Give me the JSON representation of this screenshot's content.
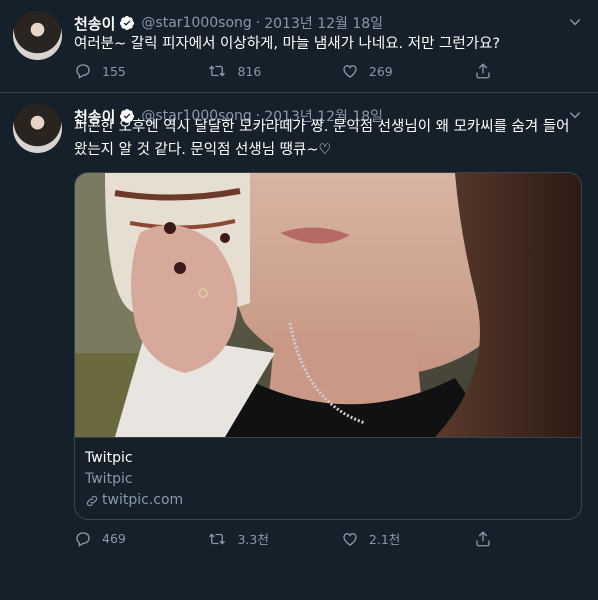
{
  "tweets": [
    {
      "author": "천송이",
      "handle": "@star1000song",
      "separator": "·",
      "date": "2013년 12월 18일",
      "text": "여러분~ 갈릭 피자에서 이상하게, 마늘 냄새가 나네요. 저만 그런가요?",
      "replies": "155",
      "retweets": "816",
      "likes": "269"
    },
    {
      "author": "천송이",
      "handle": "@star1000song",
      "separator": "·",
      "date": "2013년 12월 18일",
      "text": "피곤한 오후엔 역시 달달한 모카라떼가 짱. 문익점 선생님이 왜 모카씨를 숨겨 들어왔는지 알 것 같다. 문익점 선생님 땡큐~♡",
      "card": {
        "title": "Twitpic",
        "subtitle": "Twitpic",
        "domain": "twitpic.com"
      },
      "replies": "469",
      "retweets": "3.3천",
      "likes": "2.1천"
    }
  ],
  "icons": {
    "verified": "verified-badge-icon",
    "caret": "chevron-down-icon",
    "reply": "reply-icon",
    "retweet": "retweet-icon",
    "like": "heart-icon",
    "share": "share-icon",
    "link": "link-icon"
  },
  "colors": {
    "background": "#15202b",
    "secondary_text": "#8899a6",
    "border": "#38444d"
  }
}
